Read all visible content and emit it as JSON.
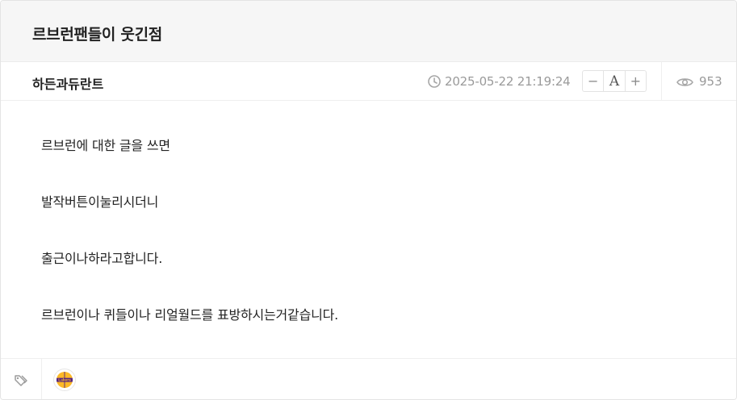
{
  "post": {
    "title": "르브런팬들이 웃긴점",
    "author": "하든과듀란트",
    "datetime": "2025-05-22 21:19:24",
    "views": "953"
  },
  "font_controls": {
    "decrease_label": "−",
    "font_label": "A",
    "increase_label": "+"
  },
  "body": {
    "paragraphs": [
      "르브런에 대한 글을 쓰면",
      "발작버튼이눌리시더니",
      "출근이나하라고합니다.",
      "르브런이나 퀴들이나 리얼월드를 표방하시는거같습니다."
    ]
  },
  "tags": {
    "icon": "tag-icon",
    "team_logo": "lakers-logo",
    "team_logo_text": "Lakers"
  },
  "colors": {
    "title_bg": "#f6f6f6",
    "meta_text": "#9a9a9a",
    "border": "#e4e4e4",
    "lakers_purple": "#552583",
    "lakers_gold": "#fdb927"
  }
}
